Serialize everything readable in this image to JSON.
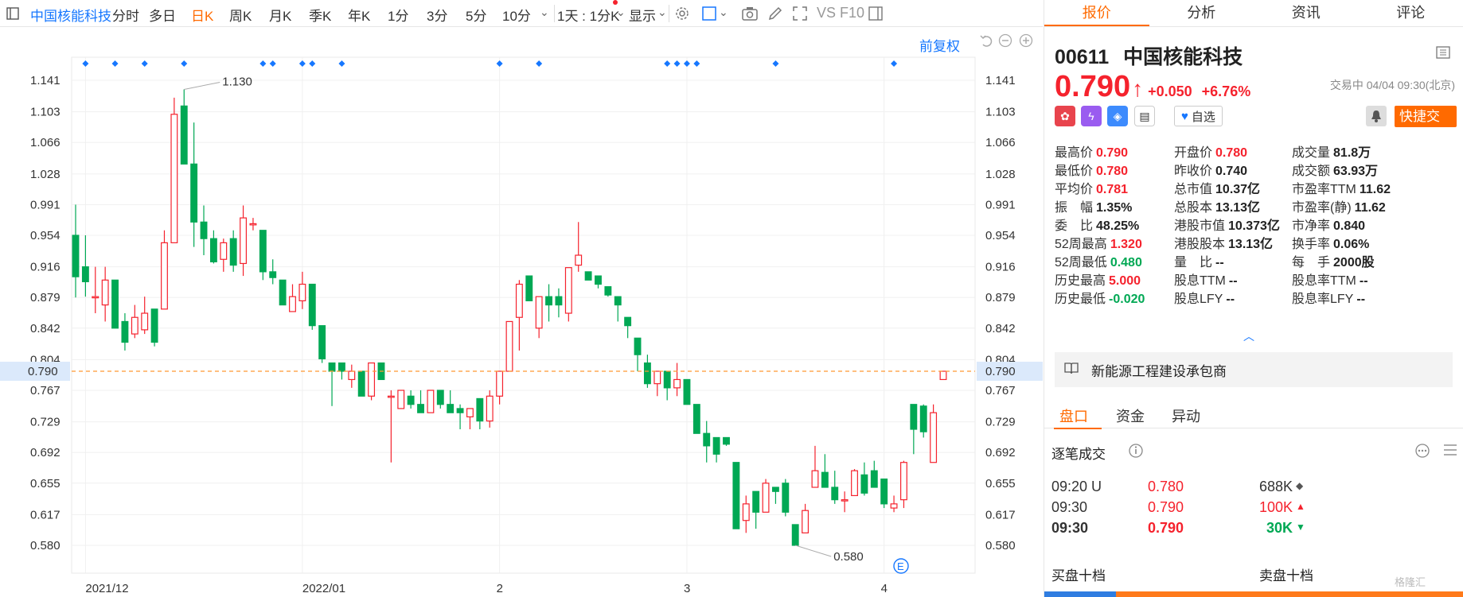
{
  "toolbar": {
    "stock_name": "中国核能科技",
    "periods": [
      "分时",
      "多日",
      "日K",
      "周K",
      "月K",
      "季K",
      "年K",
      "1分",
      "3分",
      "5分",
      "10分"
    ],
    "active_period": "日K",
    "interval_select": "1天 : 1分K",
    "display_label": "显示",
    "vs_label": "VS",
    "f10_label": "F10"
  },
  "chart": {
    "restoration_label": "前复权",
    "current_price_label": "0.790",
    "high_mark_label": "1.130",
    "low_mark_label": "0.580",
    "event_badge": "E",
    "y_ticks": [
      "1.141",
      "1.103",
      "1.066",
      "1.028",
      "0.991",
      "0.954",
      "0.916",
      "0.879",
      "0.842",
      "0.804",
      "0.767",
      "0.729",
      "0.692",
      "0.655",
      "0.617",
      "0.580"
    ],
    "x_ticks": [
      "2021/12",
      "2022/01",
      "2",
      "3",
      "4"
    ],
    "colors": {
      "up": "#f5222d",
      "down": "#00a854",
      "price_line": "#ff9933",
      "marker": "#1677ff"
    }
  },
  "chart_data": {
    "type": "candlestick",
    "ylim": [
      0.56,
      1.16
    ],
    "xlabel": "",
    "ylabel": "",
    "candles": [
      {
        "o": 0.954,
        "h": 0.991,
        "l": 0.879,
        "c": 0.904
      },
      {
        "o": 0.916,
        "h": 0.954,
        "l": 0.88,
        "c": 0.898
      },
      {
        "o": 0.88,
        "h": 0.916,
        "l": 0.86,
        "c": 0.88
      },
      {
        "o": 0.87,
        "h": 0.916,
        "l": 0.85,
        "c": 0.9
      },
      {
        "o": 0.9,
        "h": 0.9,
        "l": 0.842,
        "c": 0.842
      },
      {
        "o": 0.85,
        "h": 0.86,
        "l": 0.815,
        "c": 0.825
      },
      {
        "o": 0.835,
        "h": 0.87,
        "l": 0.83,
        "c": 0.855
      },
      {
        "o": 0.84,
        "h": 0.88,
        "l": 0.835,
        "c": 0.86
      },
      {
        "o": 0.865,
        "h": 0.865,
        "l": 0.82,
        "c": 0.825
      },
      {
        "o": 0.865,
        "h": 0.96,
        "l": 0.865,
        "c": 0.945
      },
      {
        "o": 0.945,
        "h": 1.12,
        "l": 0.945,
        "c": 1.1
      },
      {
        "o": 1.11,
        "h": 1.13,
        "l": 1.04,
        "c": 1.04
      },
      {
        "o": 1.04,
        "h": 1.09,
        "l": 0.94,
        "c": 0.97
      },
      {
        "o": 0.97,
        "h": 0.99,
        "l": 0.93,
        "c": 0.95
      },
      {
        "o": 0.95,
        "h": 0.96,
        "l": 0.92,
        "c": 0.922
      },
      {
        "o": 0.925,
        "h": 0.95,
        "l": 0.91,
        "c": 0.945
      },
      {
        "o": 0.95,
        "h": 0.96,
        "l": 0.91,
        "c": 0.918
      },
      {
        "o": 0.92,
        "h": 0.99,
        "l": 0.905,
        "c": 0.975
      },
      {
        "o": 0.968,
        "h": 0.975,
        "l": 0.96,
        "c": 0.968
      },
      {
        "o": 0.96,
        "h": 0.96,
        "l": 0.9,
        "c": 0.91
      },
      {
        "o": 0.91,
        "h": 0.925,
        "l": 0.895,
        "c": 0.903
      },
      {
        "o": 0.9,
        "h": 0.9,
        "l": 0.87,
        "c": 0.87
      },
      {
        "o": 0.862,
        "h": 0.895,
        "l": 0.862,
        "c": 0.88
      },
      {
        "o": 0.875,
        "h": 0.91,
        "l": 0.865,
        "c": 0.895
      },
      {
        "o": 0.895,
        "h": 0.895,
        "l": 0.84,
        "c": 0.845
      },
      {
        "o": 0.845,
        "h": 0.845,
        "l": 0.8,
        "c": 0.805
      },
      {
        "o": 0.8,
        "h": 0.8,
        "l": 0.748,
        "c": 0.79
      },
      {
        "o": 0.8,
        "h": 0.8,
        "l": 0.78,
        "c": 0.79
      },
      {
        "o": 0.78,
        "h": 0.798,
        "l": 0.77,
        "c": 0.79
      },
      {
        "o": 0.79,
        "h": 0.79,
        "l": 0.76,
        "c": 0.76
      },
      {
        "o": 0.76,
        "h": 0.8,
        "l": 0.755,
        "c": 0.8
      },
      {
        "o": 0.8,
        "h": 0.8,
        "l": 0.78,
        "c": 0.78
      },
      {
        "o": 0.76,
        "h": 0.767,
        "l": 0.68,
        "c": 0.76
      },
      {
        "o": 0.745,
        "h": 0.767,
        "l": 0.745,
        "c": 0.767
      },
      {
        "o": 0.76,
        "h": 0.767,
        "l": 0.745,
        "c": 0.75
      },
      {
        "o": 0.75,
        "h": 0.767,
        "l": 0.74,
        "c": 0.74
      },
      {
        "o": 0.74,
        "h": 0.767,
        "l": 0.74,
        "c": 0.767
      },
      {
        "o": 0.767,
        "h": 0.767,
        "l": 0.745,
        "c": 0.75
      },
      {
        "o": 0.75,
        "h": 0.767,
        "l": 0.74,
        "c": 0.74
      },
      {
        "o": 0.745,
        "h": 0.75,
        "l": 0.72,
        "c": 0.74
      },
      {
        "o": 0.735,
        "h": 0.745,
        "l": 0.72,
        "c": 0.745
      },
      {
        "o": 0.757,
        "h": 0.757,
        "l": 0.72,
        "c": 0.73
      },
      {
        "o": 0.73,
        "h": 0.767,
        "l": 0.722,
        "c": 0.76
      },
      {
        "o": 0.76,
        "h": 0.79,
        "l": 0.75,
        "c": 0.79
      },
      {
        "o": 0.79,
        "h": 0.85,
        "l": 0.79,
        "c": 0.85
      },
      {
        "o": 0.855,
        "h": 0.9,
        "l": 0.815,
        "c": 0.895
      },
      {
        "o": 0.905,
        "h": 0.905,
        "l": 0.875,
        "c": 0.875
      },
      {
        "o": 0.842,
        "h": 0.88,
        "l": 0.83,
        "c": 0.88
      },
      {
        "o": 0.88,
        "h": 0.895,
        "l": 0.85,
        "c": 0.87
      },
      {
        "o": 0.88,
        "h": 0.89,
        "l": 0.855,
        "c": 0.87
      },
      {
        "o": 0.86,
        "h": 0.915,
        "l": 0.85,
        "c": 0.915
      },
      {
        "o": 0.918,
        "h": 0.97,
        "l": 0.91,
        "c": 0.93
      },
      {
        "o": 0.91,
        "h": 0.91,
        "l": 0.9,
        "c": 0.9
      },
      {
        "o": 0.905,
        "h": 0.905,
        "l": 0.89,
        "c": 0.895
      },
      {
        "o": 0.892,
        "h": 0.892,
        "l": 0.88,
        "c": 0.882
      },
      {
        "o": 0.88,
        "h": 0.88,
        "l": 0.85,
        "c": 0.87
      },
      {
        "o": 0.855,
        "h": 0.855,
        "l": 0.83,
        "c": 0.845
      },
      {
        "o": 0.83,
        "h": 0.83,
        "l": 0.79,
        "c": 0.81
      },
      {
        "o": 0.8,
        "h": 0.81,
        "l": 0.77,
        "c": 0.775
      },
      {
        "o": 0.775,
        "h": 0.79,
        "l": 0.76,
        "c": 0.79
      },
      {
        "o": 0.79,
        "h": 0.79,
        "l": 0.755,
        "c": 0.77
      },
      {
        "o": 0.77,
        "h": 0.8,
        "l": 0.76,
        "c": 0.78
      },
      {
        "o": 0.78,
        "h": 0.78,
        "l": 0.75,
        "c": 0.75
      },
      {
        "o": 0.75,
        "h": 0.75,
        "l": 0.715,
        "c": 0.715
      },
      {
        "o": 0.715,
        "h": 0.73,
        "l": 0.68,
        "c": 0.7
      },
      {
        "o": 0.71,
        "h": 0.71,
        "l": 0.68,
        "c": 0.69
      },
      {
        "o": 0.71,
        "h": 0.71,
        "l": 0.7,
        "c": 0.702
      },
      {
        "o": 0.68,
        "h": 0.68,
        "l": 0.6,
        "c": 0.6
      },
      {
        "o": 0.61,
        "h": 0.64,
        "l": 0.595,
        "c": 0.63
      },
      {
        "o": 0.645,
        "h": 0.645,
        "l": 0.6,
        "c": 0.62
      },
      {
        "o": 0.62,
        "h": 0.66,
        "l": 0.62,
        "c": 0.655
      },
      {
        "o": 0.65,
        "h": 0.65,
        "l": 0.63,
        "c": 0.645
      },
      {
        "o": 0.655,
        "h": 0.66,
        "l": 0.615,
        "c": 0.62
      },
      {
        "o": 0.605,
        "h": 0.605,
        "l": 0.58,
        "c": 0.58
      },
      {
        "o": 0.595,
        "h": 0.63,
        "l": 0.595,
        "c": 0.622
      },
      {
        "o": 0.65,
        "h": 0.7,
        "l": 0.65,
        "c": 0.67
      },
      {
        "o": 0.668,
        "h": 0.69,
        "l": 0.65,
        "c": 0.65
      },
      {
        "o": 0.65,
        "h": 0.67,
        "l": 0.63,
        "c": 0.635
      },
      {
        "o": 0.635,
        "h": 0.645,
        "l": 0.62,
        "c": 0.635
      },
      {
        "o": 0.64,
        "h": 0.672,
        "l": 0.64,
        "c": 0.67
      },
      {
        "o": 0.665,
        "h": 0.68,
        "l": 0.64,
        "c": 0.643
      },
      {
        "o": 0.67,
        "h": 0.682,
        "l": 0.65,
        "c": 0.65
      },
      {
        "o": 0.66,
        "h": 0.66,
        "l": 0.625,
        "c": 0.63
      },
      {
        "o": 0.625,
        "h": 0.64,
        "l": 0.62,
        "c": 0.63
      },
      {
        "o": 0.635,
        "h": 0.682,
        "l": 0.625,
        "c": 0.68
      },
      {
        "o": 0.75,
        "h": 0.75,
        "l": 0.69,
        "c": 0.72
      },
      {
        "o": 0.748,
        "h": 0.75,
        "l": 0.71,
        "c": 0.717
      },
      {
        "o": 0.68,
        "h": 0.75,
        "l": 0.68,
        "c": 0.74
      },
      {
        "o": 0.78,
        "h": 0.79,
        "l": 0.78,
        "c": 0.79
      }
    ],
    "marker_days": [
      1,
      4,
      7,
      11,
      19,
      20,
      23,
      24,
      27,
      43,
      47,
      60,
      61,
      62,
      63,
      71,
      83
    ],
    "current_price": 0.79,
    "high": 1.13,
    "low": 0.58
  },
  "quote": {
    "code": "00611",
    "name": "中国核能科技",
    "price": "0.790",
    "change": "+0.050",
    "change_pct": "+6.76%",
    "status": "交易中 04/04 09:30(北京)",
    "fav_label": "自选",
    "quick_trade_label": "快捷交易",
    "fields": [
      {
        "label": "最高价",
        "value": "0.790",
        "color": "red",
        "col": 0,
        "row": 0
      },
      {
        "label": "开盘价",
        "value": "0.780",
        "color": "red",
        "col": 1,
        "row": 0
      },
      {
        "label": "成交量",
        "value": "81.8万",
        "color": "dark",
        "col": 2,
        "row": 0
      },
      {
        "label": "最低价",
        "value": "0.780",
        "color": "red",
        "col": 0,
        "row": 1
      },
      {
        "label": "昨收价",
        "value": "0.740",
        "color": "dark",
        "col": 1,
        "row": 1
      },
      {
        "label": "成交额",
        "value": "63.93万",
        "color": "dark",
        "col": 2,
        "row": 1
      },
      {
        "label": "平均价",
        "value": "0.781",
        "color": "red",
        "col": 0,
        "row": 2
      },
      {
        "label": "总市值",
        "value": "10.37亿",
        "color": "dark",
        "col": 1,
        "row": 2
      },
      {
        "label": "市盈率TTM",
        "value": "11.62",
        "color": "dark",
        "col": 2,
        "row": 2
      },
      {
        "label": "振　幅",
        "value": "1.35%",
        "color": "dark",
        "col": 0,
        "row": 3
      },
      {
        "label": "总股本",
        "value": "13.13亿",
        "color": "dark",
        "col": 1,
        "row": 3
      },
      {
        "label": "市盈率(静)",
        "value": "11.62",
        "color": "dark",
        "col": 2,
        "row": 3
      },
      {
        "label": "委　比",
        "value": "48.25%",
        "color": "dark",
        "col": 0,
        "row": 4
      },
      {
        "label": "港股市值",
        "value": "10.373亿",
        "color": "dark",
        "col": 1,
        "row": 4
      },
      {
        "label": "市净率",
        "value": "0.840",
        "color": "dark",
        "col": 2,
        "row": 4
      },
      {
        "label": "52周最高",
        "value": "1.320",
        "color": "red",
        "col": 0,
        "row": 5
      },
      {
        "label": "港股股本",
        "value": "13.13亿",
        "color": "dark",
        "col": 1,
        "row": 5
      },
      {
        "label": "换手率",
        "value": "0.06%",
        "color": "dark",
        "col": 2,
        "row": 5
      },
      {
        "label": "52周最低",
        "value": "0.480",
        "color": "green",
        "col": 0,
        "row": 6
      },
      {
        "label": "量　比",
        "value": "--",
        "color": "dark",
        "col": 1,
        "row": 6
      },
      {
        "label": "每　手",
        "value": "2000股",
        "color": "dark",
        "col": 2,
        "row": 6
      },
      {
        "label": "历史最高",
        "value": "5.000",
        "color": "red",
        "col": 0,
        "row": 7
      },
      {
        "label": "股息TTM",
        "value": "--",
        "color": "dark",
        "col": 1,
        "row": 7
      },
      {
        "label": "股息率TTM",
        "value": "--",
        "color": "dark",
        "col": 2,
        "row": 7
      },
      {
        "label": "历史最低",
        "value": "-0.020",
        "color": "green",
        "col": 0,
        "row": 8
      },
      {
        "label": "股息LFY",
        "value": "--",
        "color": "dark",
        "col": 1,
        "row": 8
      },
      {
        "label": "股息率LFY",
        "value": "--",
        "color": "dark",
        "col": 2,
        "row": 8
      }
    ],
    "profile": "新能源工程建设承包商"
  },
  "panel_tabs": [
    "报价",
    "分析",
    "资讯",
    "评论"
  ],
  "sub_tabs": [
    "盘口",
    "资金",
    "异动"
  ],
  "ticks": {
    "title": "逐笔成交",
    "rows": [
      {
        "time": "09:20 U",
        "price": "0.780",
        "vol": "688K",
        "dir": "neutral"
      },
      {
        "time": "09:30",
        "price": "0.790",
        "vol": "100K",
        "dir": "up"
      },
      {
        "time": "09:30",
        "price": "0.790",
        "vol": "30K",
        "dir": "down"
      }
    ]
  },
  "depth": {
    "buy_label": "买盘十档",
    "sell_label": "卖盘十档"
  },
  "watermark": "格隆汇"
}
